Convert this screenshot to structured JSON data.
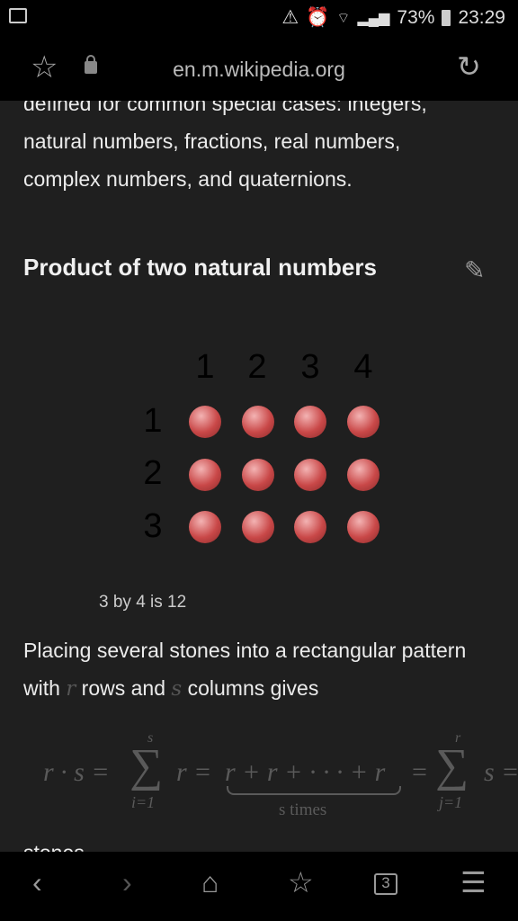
{
  "status": {
    "battery": "73%",
    "time": "23:29",
    "icons": [
      "image-icon",
      "sync-icon",
      "alarm-icon",
      "wifi-icon",
      "signal-icon",
      "battery-icon"
    ]
  },
  "urlbar": {
    "url": "en.m.wikipedia.org"
  },
  "article": {
    "intro_cut": "defined for common special cases: integers,",
    "intro": "natural numbers, fractions, real numbers, complex numbers, and quaternions.",
    "heading": "Product of two natural numbers",
    "diagram": {
      "cols": [
        "1",
        "2",
        "3",
        "4"
      ],
      "rows": [
        "1",
        "2",
        "3"
      ],
      "color": "#c94848"
    },
    "caption": "3 by 4 is 12",
    "para_a": "Placing several stones into a rectangular pattern with ",
    "var_r": "r",
    "para_b": " rows and ",
    "var_s": "s",
    "para_c": " columns gives",
    "formula": {
      "lhs": "r · s =",
      "sum1_top": "s",
      "sum1_bot": "i=1",
      "mid1": "r =",
      "expansion": "r + r + · · · + r",
      "brace_label": "s times",
      "eq2": "=",
      "sum2_top": "r",
      "sum2_bot": "j=1",
      "tail": "s ="
    },
    "next_cut": "stones"
  },
  "bottom": {
    "tabs_count": "3"
  }
}
